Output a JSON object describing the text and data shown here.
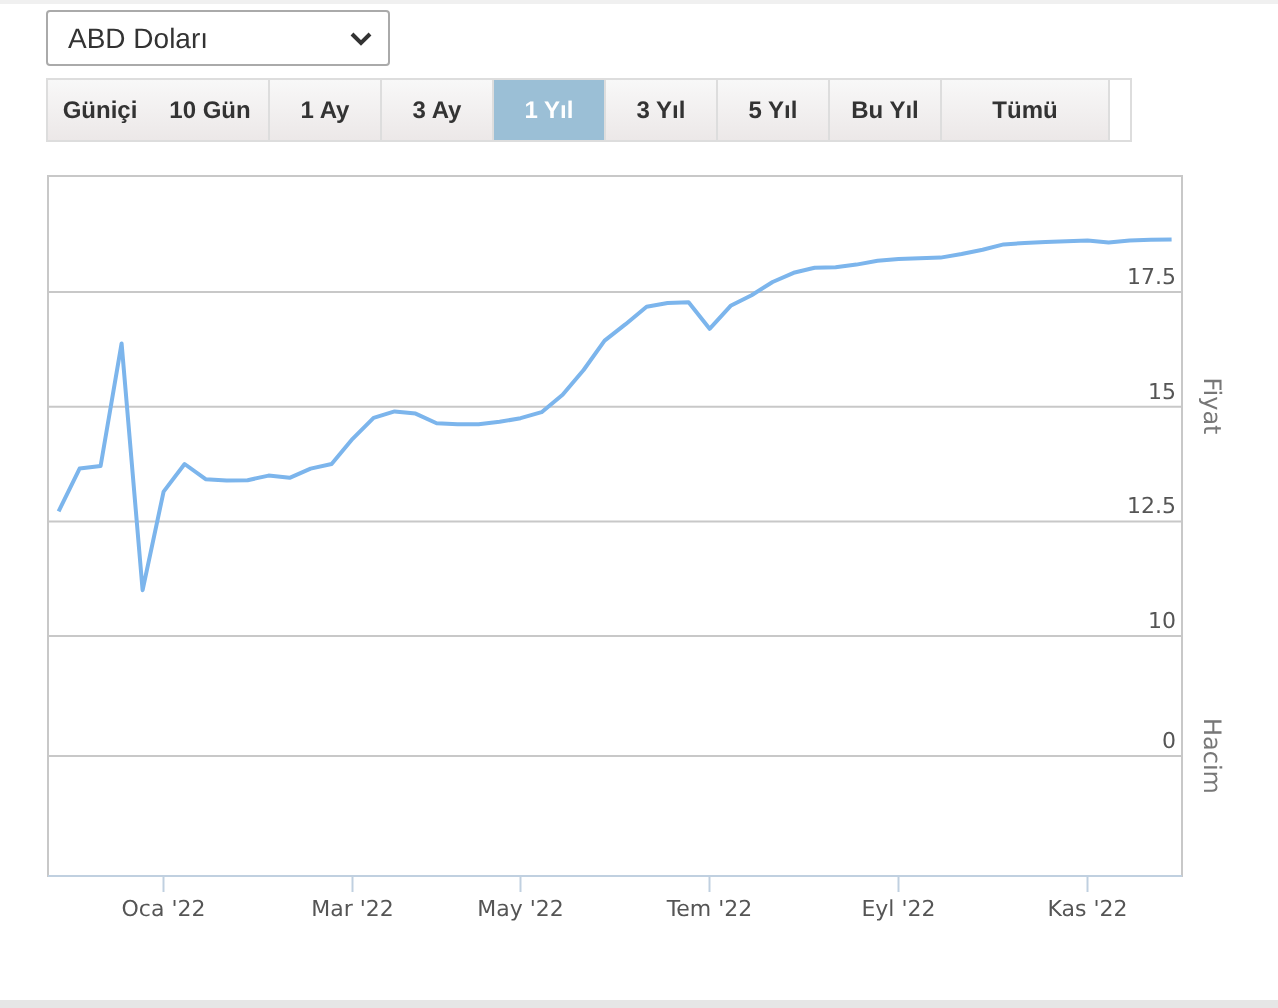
{
  "currency_select": {
    "value": "ABD Doları"
  },
  "tabs": [
    {
      "label": "Güniçi",
      "selected": false,
      "kind": "joined"
    },
    {
      "label": "10 Gün",
      "selected": false,
      "kind": "cell"
    },
    {
      "label": "1 Ay",
      "selected": false,
      "kind": "cell"
    },
    {
      "label": "3 Ay",
      "selected": false,
      "kind": "cell"
    },
    {
      "label": "1 Yıl",
      "selected": true,
      "kind": "cell"
    },
    {
      "label": "3 Yıl",
      "selected": false,
      "kind": "cell"
    },
    {
      "label": "5 Yıl",
      "selected": false,
      "kind": "cell"
    },
    {
      "label": "Bu Yıl",
      "selected": false,
      "kind": "cell"
    },
    {
      "label": "Tümü",
      "selected": false,
      "kind": "wide"
    }
  ],
  "chart": {
    "chart_data": {
      "type": "line",
      "ylabel": "Fiyat",
      "categories": [
        null,
        null,
        null,
        null,
        null,
        "Oca '22",
        null,
        null,
        null,
        null,
        null,
        null,
        null,
        null,
        "Mar '22",
        null,
        null,
        null,
        null,
        null,
        null,
        null,
        "May '22",
        null,
        null,
        null,
        null,
        null,
        null,
        null,
        null,
        "Tem '22",
        null,
        null,
        null,
        null,
        null,
        null,
        null,
        null,
        "Eyl '22",
        null,
        null,
        null,
        null,
        null,
        null,
        null,
        null,
        "Kas '22",
        null,
        null,
        null,
        null
      ],
      "series": [
        {
          "color": "#7cb5ec",
          "values": [
            12.72,
            13.65,
            13.71,
            16.38,
            11.0,
            13.15,
            13.75,
            13.42,
            13.39,
            13.4,
            13.5,
            13.45,
            13.65,
            13.75,
            14.3,
            14.76,
            14.9,
            14.85,
            14.64,
            14.62,
            14.62,
            14.67,
            14.75,
            14.88,
            15.26,
            15.8,
            16.44,
            16.8,
            17.18,
            17.26,
            17.28,
            16.7,
            17.2,
            17.43,
            17.72,
            17.92,
            18.03,
            18.04,
            18.1,
            18.18,
            18.22,
            18.24,
            18.25,
            18.33,
            18.42,
            18.54,
            18.57,
            18.59,
            18.61,
            18.62,
            18.58,
            18.62,
            18.64,
            18.65
          ]
        }
      ],
      "ylim": [
        4.77,
        20.03
      ],
      "grid": true,
      "yticks": [
        {
          "value": 10,
          "label": "10"
        },
        {
          "value": 12.5,
          "label": "12.5"
        },
        {
          "value": 15,
          "label": "15"
        },
        {
          "value": 17.5,
          "label": "17.5"
        }
      ]
    },
    "volume_pane": {
      "ylabel": "Hacim",
      "yticks": [
        "0"
      ]
    }
  }
}
